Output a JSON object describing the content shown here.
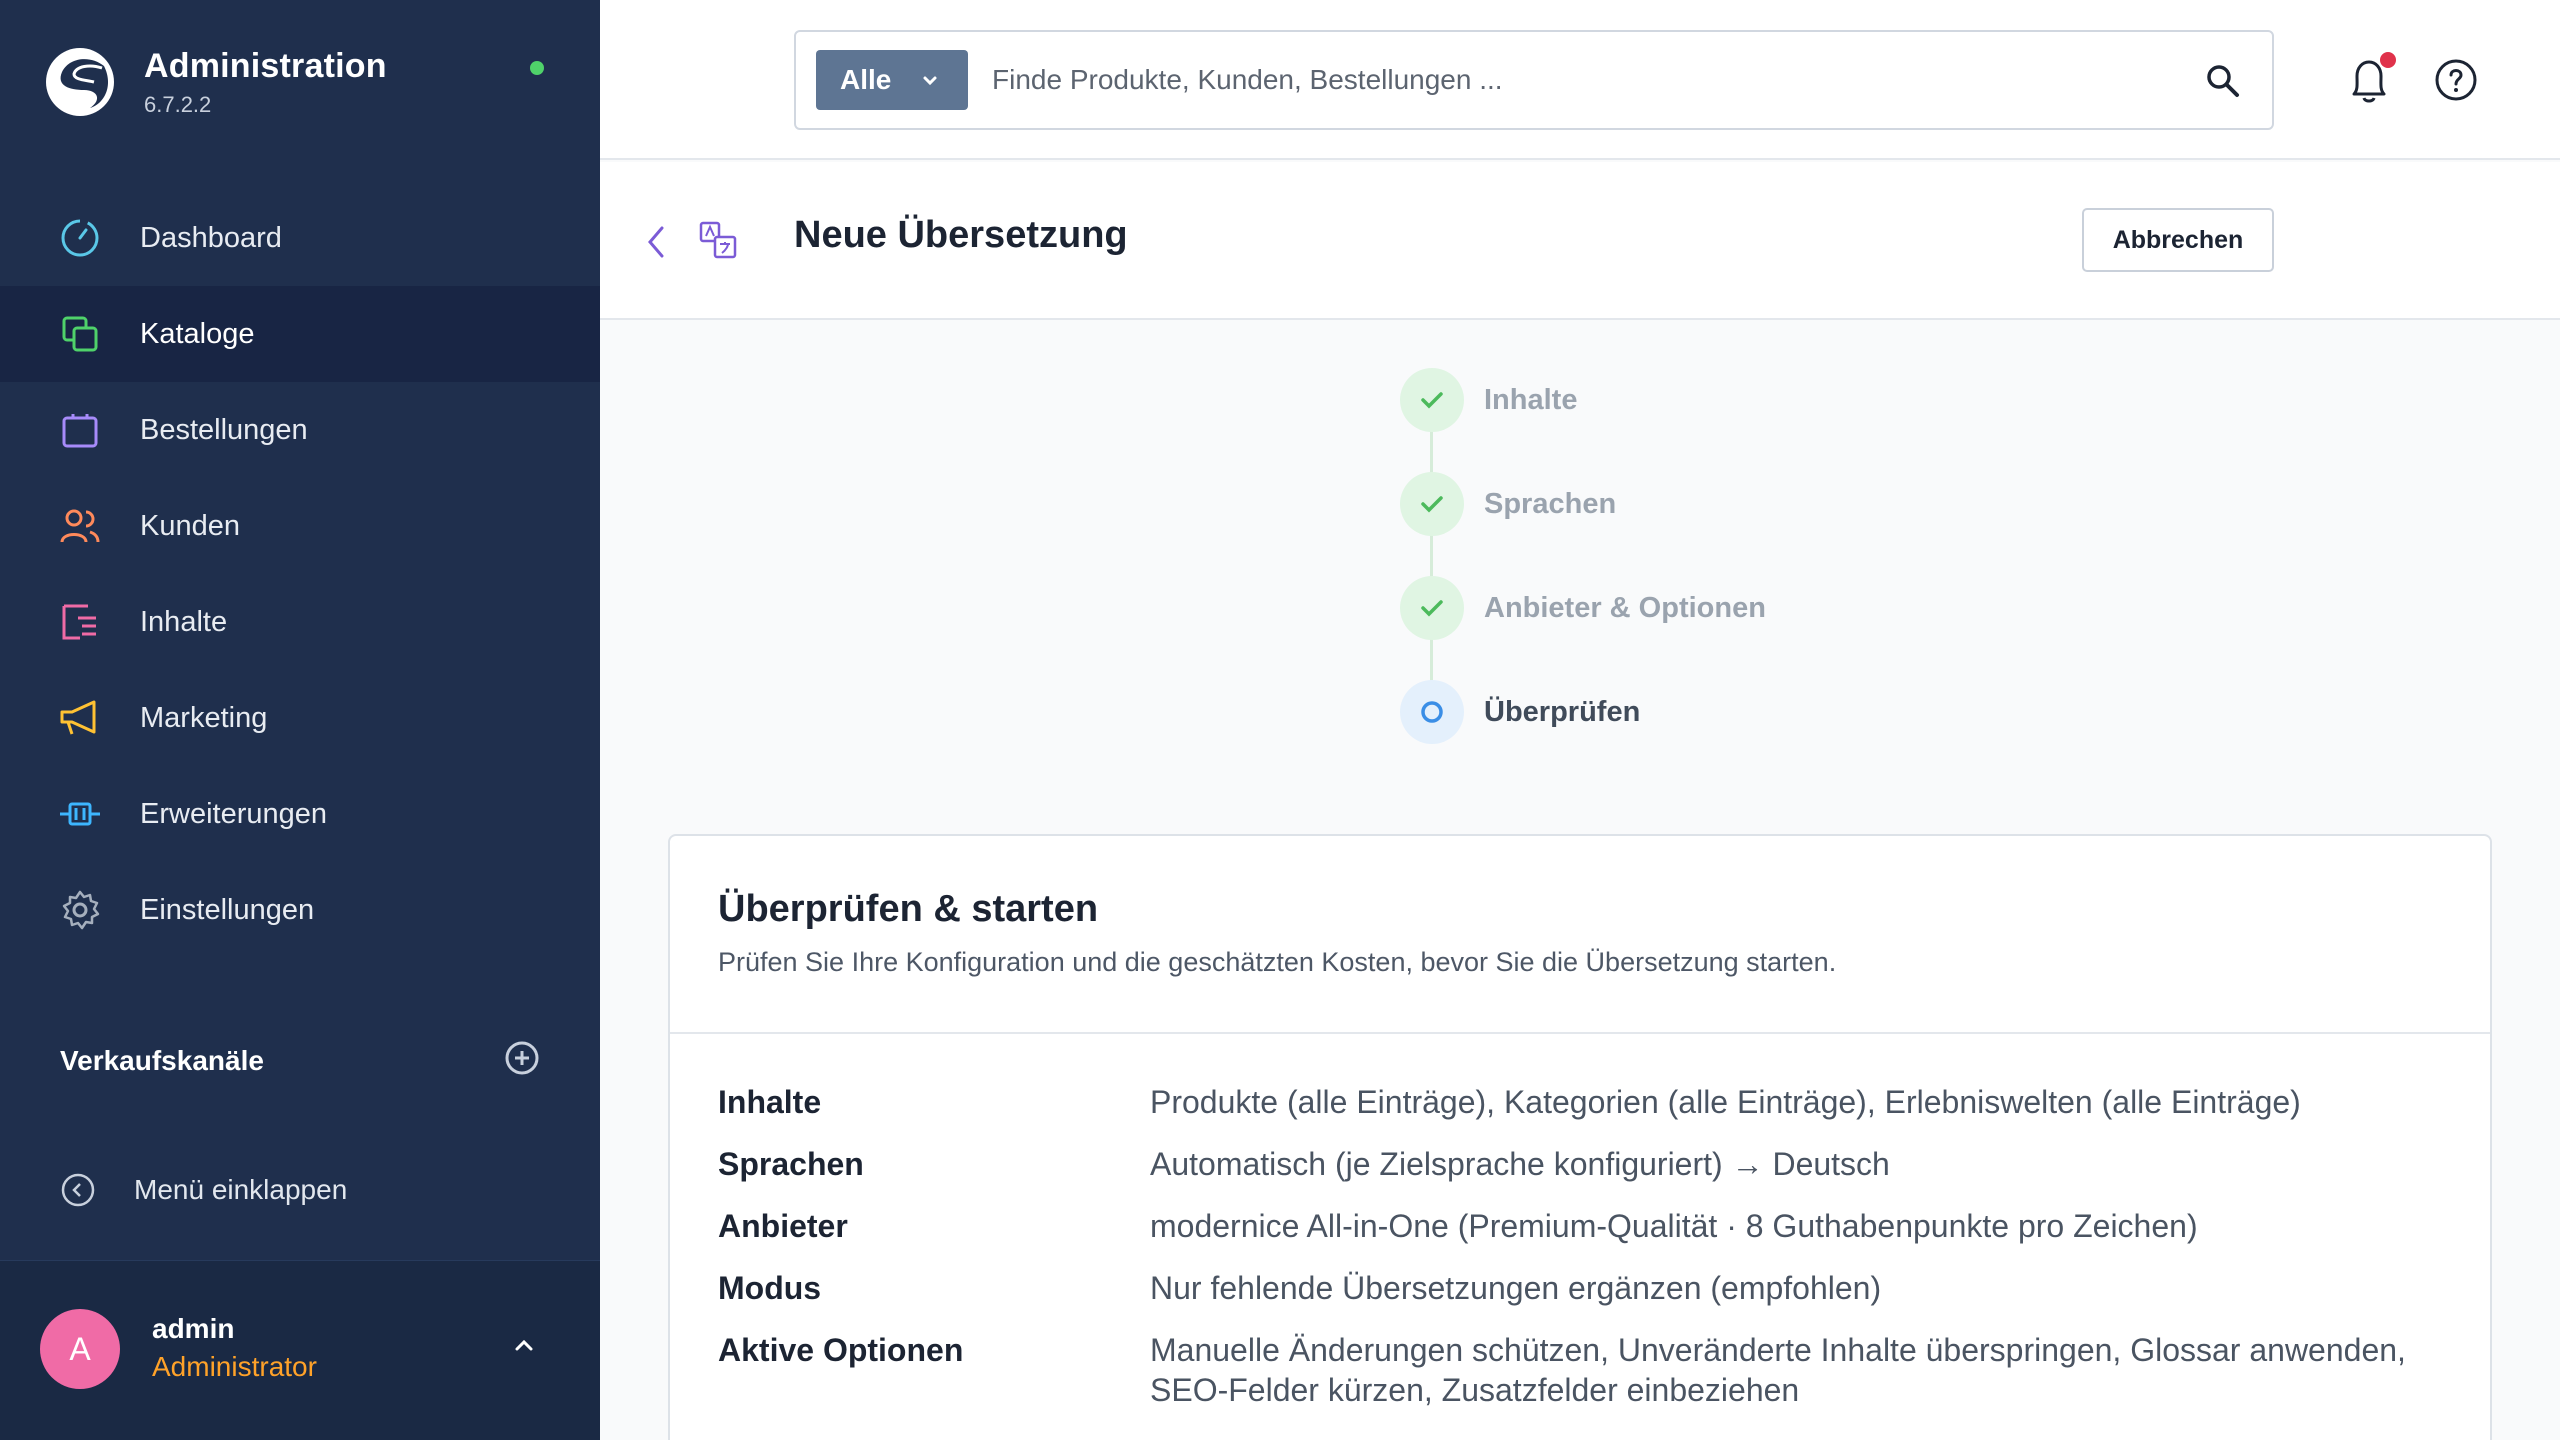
{
  "brand": {
    "title": "Administration",
    "version": "6.7.2.2"
  },
  "nav": {
    "items": [
      {
        "label": "Dashboard",
        "icon": "dashboard-icon",
        "color": "#5ac8e8"
      },
      {
        "label": "Kataloge",
        "icon": "catalog-icon",
        "color": "#4fd26a",
        "active": true
      },
      {
        "label": "Bestellungen",
        "icon": "orders-icon",
        "color": "#a78bfa"
      },
      {
        "label": "Kunden",
        "icon": "customers-icon",
        "color": "#ff8a5b"
      },
      {
        "label": "Inhalte",
        "icon": "content-icon",
        "color": "#f06ba6"
      },
      {
        "label": "Marketing",
        "icon": "marketing-icon",
        "color": "#ffc233"
      },
      {
        "label": "Erweiterungen",
        "icon": "extensions-icon",
        "color": "#3db6ff"
      },
      {
        "label": "Einstellungen",
        "icon": "settings-icon",
        "color": "#a5afbd"
      }
    ],
    "channels_label": "Verkaufskanäle",
    "collapse_label": "Menü einklappen"
  },
  "user": {
    "initial": "A",
    "name": "admin",
    "role": "Administrator"
  },
  "search": {
    "scope": "Alle",
    "placeholder": "Finde Produkte, Kunden, Bestellungen ..."
  },
  "page": {
    "title": "Neue Übersetzung",
    "cancel_label": "Abbrechen"
  },
  "steps": [
    {
      "label": "Inhalte",
      "state": "done"
    },
    {
      "label": "Sprachen",
      "state": "done"
    },
    {
      "label": "Anbieter & Optionen",
      "state": "done"
    },
    {
      "label": "Überprüfen",
      "state": "current"
    }
  ],
  "review": {
    "title": "Überprüfen & starten",
    "subtitle": "Prüfen Sie Ihre Konfiguration und die geschätzten Kosten, bevor Sie die Übersetzung starten.",
    "rows": [
      {
        "key": "Inhalte",
        "value": "Produkte (alle Einträge), Kategorien (alle Einträge), Erlebniswelten (alle Einträge)"
      },
      {
        "key": "Sprachen",
        "value": "Automatisch (je Zielsprache konfiguriert) → Deutsch"
      },
      {
        "key": "Anbieter",
        "value": "modernice All-in-One (Premium-Qualität · 8 Guthabenpunkte pro Zeichen)"
      },
      {
        "key": "Modus",
        "value": "Nur fehlende Übersetzungen ergänzen (empfohlen)"
      },
      {
        "key": "Aktive Optionen",
        "value": "Manuelle Änderungen schützen, Unveränderte Inhalte überspringen, Glossar anwenden, SEO-Felder kürzen, Zusatzfelder einbeziehen"
      }
    ]
  },
  "colors": {
    "sidebar": "#1f2f4d",
    "active": "#182544",
    "success": "#4fd26a",
    "current": "#3a8ee6",
    "notify": "#e0324b",
    "user_role": "#ffa229"
  }
}
